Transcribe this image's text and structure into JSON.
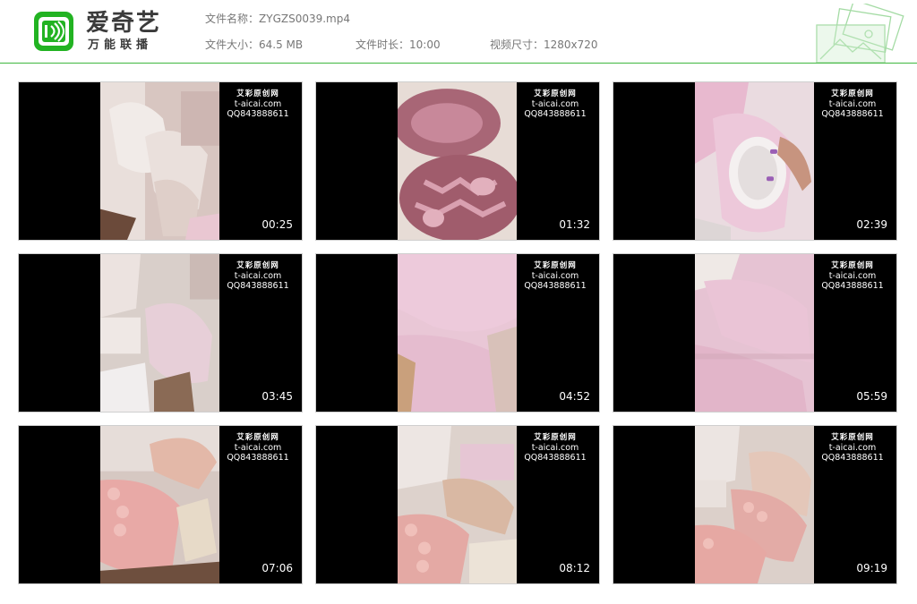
{
  "header": {
    "brand_name": "爱奇艺",
    "brand_sub": "万能联播",
    "file_name_label": "文件名称：",
    "file_name": "ZYGZS0039.mp4",
    "file_size_label": "文件大小：",
    "file_size": "64.5 MB",
    "duration_label": "文件时长：",
    "duration": "10:00",
    "resolution_label": "视频尺寸：",
    "resolution": "1280x720",
    "accent_color": "#3fb73f",
    "logo_icon": "iqiyi-logo-icon",
    "decoration_icon": "photo-frames-icon"
  },
  "watermark": {
    "line1": "艾彩原创网",
    "line2": "t-aicai.com",
    "line3": "QQ843888611"
  },
  "thumbnails": [
    {
      "timestamp": "00:25",
      "scene": "sneakers-pink"
    },
    {
      "timestamp": "01:32",
      "scene": "shoe-soles"
    },
    {
      "timestamp": "02:39",
      "scene": "shoe-hand"
    },
    {
      "timestamp": "03:45",
      "scene": "sock-sneaker"
    },
    {
      "timestamp": "04:52",
      "scene": "pink-socks"
    },
    {
      "timestamp": "05:59",
      "scene": "pink-socks-close"
    },
    {
      "timestamp": "07:06",
      "scene": "bare-feet"
    },
    {
      "timestamp": "08:12",
      "scene": "bare-feet-2"
    },
    {
      "timestamp": "09:19",
      "scene": "bare-feet-3"
    }
  ]
}
